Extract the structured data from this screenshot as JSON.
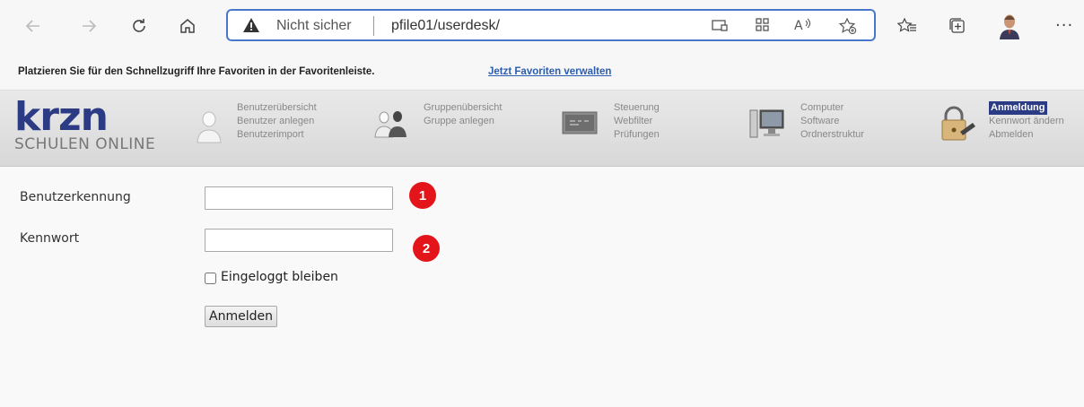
{
  "browser": {
    "security_label": "Nicht sicher",
    "url": "pfile01/userdesk/",
    "more_label": "···"
  },
  "favorites_bar": {
    "message": "Platzieren Sie für den Schnellzugriff Ihre Favoriten in der Favoritenleiste.",
    "link_label": "Jetzt Favoriten verwalten"
  },
  "app": {
    "logo_main": "krzn",
    "logo_sub": "SCHULEN ONLINE",
    "nav_groups": [
      {
        "icon": "user-icon",
        "links": [
          "Benutzerübersicht",
          "Benutzer anlegen",
          "Benutzerimport"
        ]
      },
      {
        "icon": "group-icon",
        "links": [
          "Gruppenübersicht",
          "Gruppe anlegen"
        ]
      },
      {
        "icon": "blackboard-icon",
        "links": [
          "Steuerung",
          "Webfilter",
          "Prüfungen"
        ]
      },
      {
        "icon": "computer-icon",
        "links": [
          "Computer",
          "Software",
          "Ordnerstruktur"
        ]
      },
      {
        "icon": "padlock-key-icon",
        "links": [
          "Anmeldung",
          "Kennwort ändern",
          "Abmelden"
        ],
        "active": "Anmeldung"
      }
    ]
  },
  "form": {
    "username_label": "Benutzerkennung",
    "password_label": "Kennwort",
    "username_value": "",
    "password_value": "",
    "remember_label": "Eingeloggt bleiben",
    "remember_checked": false,
    "submit_label": "Anmelden",
    "markers": [
      "1",
      "2"
    ]
  },
  "colors": {
    "accent": "#2b3b84",
    "marker": "#e4151a",
    "address_border": "#4a78c8"
  }
}
